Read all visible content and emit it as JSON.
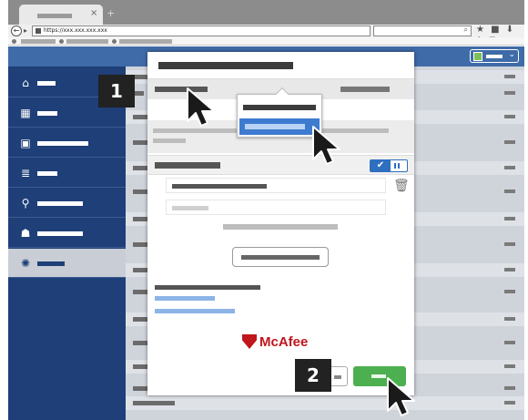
{
  "browser": {
    "tab": {
      "close": "×"
    },
    "new_tab": "+",
    "back": "←",
    "url": "https://xxx.xxx.xxx.xxx",
    "search_icon": "⌕",
    "toolbar_icons": "★ ■ ⬇ ⌂ ≡"
  },
  "header": {
    "user_chevron": "⌄"
  },
  "sidebar": {
    "items": [
      {
        "icon": "home-icon",
        "glyph": "⌂"
      },
      {
        "icon": "grid-icon",
        "glyph": "▦"
      },
      {
        "icon": "device-icon",
        "glyph": "▣"
      },
      {
        "icon": "storage-icon",
        "glyph": "≣"
      },
      {
        "icon": "share-icon",
        "glyph": "⚲"
      },
      {
        "icon": "users-icon",
        "glyph": "☗"
      },
      {
        "icon": "settings-icon",
        "glyph": "✺"
      }
    ],
    "active_index": 6
  },
  "modal": {
    "toggle_on_glyph": "✔",
    "trash_glyph": "🗑",
    "brand": "McAfee"
  },
  "steps": {
    "step1": "1",
    "step2": "2"
  },
  "colors": {
    "app_blue": "#1e3f77",
    "header_blue": "#3f6ba8",
    "highlight_blue": "#3d7bd0",
    "ok_green": "#4caf50",
    "brand_red": "#c0161c"
  }
}
